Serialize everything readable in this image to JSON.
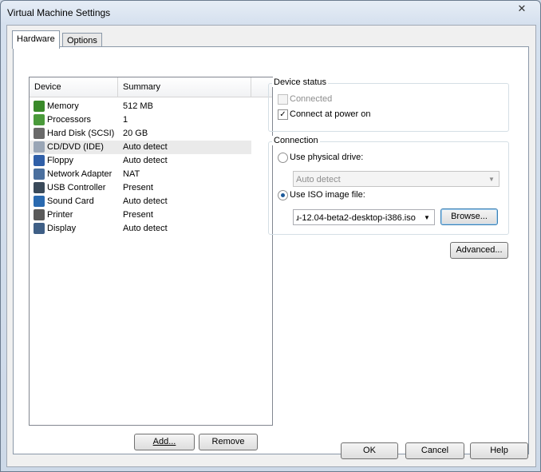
{
  "window": {
    "title": "Virtual Machine Settings",
    "close_glyph": "✕"
  },
  "tabs": [
    {
      "label": "Hardware",
      "active": true
    },
    {
      "label": "Options",
      "active": false
    }
  ],
  "device_table": {
    "headers": [
      "Device",
      "Summary"
    ],
    "rows": [
      {
        "device": "Memory",
        "summary": "512 MB",
        "icon": "memory-icon",
        "color": "#3a8a2a"
      },
      {
        "device": "Processors",
        "summary": "1",
        "icon": "processor-icon",
        "color": "#4a9a3a"
      },
      {
        "device": "Hard Disk (SCSI)",
        "summary": "20 GB",
        "icon": "hard-disk-icon",
        "color": "#6a6a6a"
      },
      {
        "device": "CD/DVD (IDE)",
        "summary": "Auto detect",
        "icon": "cd-dvd-icon",
        "color": "#9aa6b6",
        "selected": true
      },
      {
        "device": "Floppy",
        "summary": "Auto detect",
        "icon": "floppy-icon",
        "color": "#2f5fa8"
      },
      {
        "device": "Network Adapter",
        "summary": "NAT",
        "icon": "network-adapter-icon",
        "color": "#4a6f9e"
      },
      {
        "device": "USB Controller",
        "summary": "Present",
        "icon": "usb-icon",
        "color": "#3a4a5a"
      },
      {
        "device": "Sound Card",
        "summary": "Auto detect",
        "icon": "sound-card-icon",
        "color": "#2a6ab0"
      },
      {
        "device": "Printer",
        "summary": "Present",
        "icon": "printer-icon",
        "color": "#5a5a5a"
      },
      {
        "device": "Display",
        "summary": "Auto detect",
        "icon": "display-icon",
        "color": "#3f5f86"
      }
    ]
  },
  "buttons": {
    "add": "Add...",
    "remove": "Remove",
    "browse": "Browse...",
    "advanced": "Advanced...",
    "ok": "OK",
    "cancel": "Cancel",
    "help": "Help"
  },
  "device_status": {
    "title": "Device status",
    "connected": {
      "label": "Connected",
      "checked": false,
      "enabled": false
    },
    "connect_at_power_on": {
      "label": "Connect at power on",
      "checked": true,
      "enabled": true
    }
  },
  "connection": {
    "title": "Connection",
    "use_physical_drive": {
      "label": "Use physical drive:",
      "selected": false
    },
    "physical_drive_value": "Auto detect",
    "use_iso_image": {
      "label": "Use ISO image file:",
      "selected": true
    },
    "iso_path": "ɹ-12.04-beta2-desktop-i386.iso"
  },
  "glyphs": {
    "check": "✓",
    "dropdown_arrow": "▼"
  }
}
